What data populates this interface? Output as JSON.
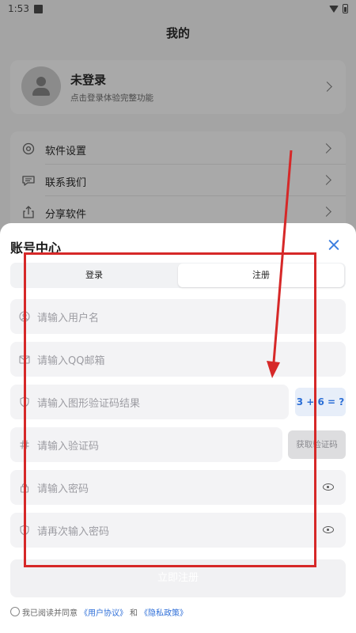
{
  "status_bar": {
    "time": "1:53"
  },
  "page": {
    "title": "我的"
  },
  "profile": {
    "name": "未登录",
    "subtitle": "点击登录体验完整功能"
  },
  "menu": {
    "items": [
      {
        "label": "软件设置",
        "icon": "gear-icon"
      },
      {
        "label": "联系我们",
        "icon": "chat-icon"
      },
      {
        "label": "分享软件",
        "icon": "share-icon"
      }
    ]
  },
  "sheet": {
    "title": "账号中心",
    "tabs": {
      "login": "登录",
      "register": "注册",
      "active": "register"
    },
    "fields": {
      "username": {
        "placeholder": "请输入用户名",
        "icon": "user-icon"
      },
      "qq_email": {
        "placeholder": "请输入QQ邮箱",
        "icon": "mail-icon"
      },
      "captcha": {
        "placeholder": "请输入图形验证码结果",
        "icon": "shield-icon"
      },
      "code": {
        "placeholder": "请输入验证码",
        "icon": "hash-icon"
      },
      "password": {
        "placeholder": "请输入密码",
        "icon": "lock-icon"
      },
      "password_confirm": {
        "placeholder": "请再次输入密码",
        "icon": "shield-lock-icon"
      }
    },
    "captcha_question": "3 + 6 = ?",
    "get_code_label": "获取验证码",
    "submit_label": "立即注册",
    "agreement": {
      "prefix": "我已阅读并同意",
      "user_agreement": "《用户协议》",
      "and": "和",
      "privacy_policy": "《隐私政策》"
    }
  },
  "colors": {
    "accent": "#3d7fe0",
    "annotation": "#d62828"
  }
}
